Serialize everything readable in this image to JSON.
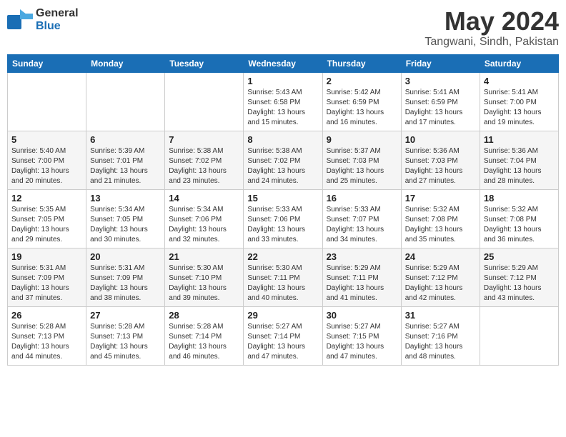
{
  "logo": {
    "general": "General",
    "blue": "Blue"
  },
  "header": {
    "title": "May 2024",
    "subtitle": "Tangwani, Sindh, Pakistan"
  },
  "days": [
    "Sunday",
    "Monday",
    "Tuesday",
    "Wednesday",
    "Thursday",
    "Friday",
    "Saturday"
  ],
  "weeks": [
    [
      {
        "date": "",
        "info": ""
      },
      {
        "date": "",
        "info": ""
      },
      {
        "date": "",
        "info": ""
      },
      {
        "date": "1",
        "info": "Sunrise: 5:43 AM\nSunset: 6:58 PM\nDaylight: 13 hours and 15 minutes."
      },
      {
        "date": "2",
        "info": "Sunrise: 5:42 AM\nSunset: 6:59 PM\nDaylight: 13 hours and 16 minutes."
      },
      {
        "date": "3",
        "info": "Sunrise: 5:41 AM\nSunset: 6:59 PM\nDaylight: 13 hours and 17 minutes."
      },
      {
        "date": "4",
        "info": "Sunrise: 5:41 AM\nSunset: 7:00 PM\nDaylight: 13 hours and 19 minutes."
      }
    ],
    [
      {
        "date": "5",
        "info": "Sunrise: 5:40 AM\nSunset: 7:00 PM\nDaylight: 13 hours and 20 minutes."
      },
      {
        "date": "6",
        "info": "Sunrise: 5:39 AM\nSunset: 7:01 PM\nDaylight: 13 hours and 21 minutes."
      },
      {
        "date": "7",
        "info": "Sunrise: 5:38 AM\nSunset: 7:02 PM\nDaylight: 13 hours and 23 minutes."
      },
      {
        "date": "8",
        "info": "Sunrise: 5:38 AM\nSunset: 7:02 PM\nDaylight: 13 hours and 24 minutes."
      },
      {
        "date": "9",
        "info": "Sunrise: 5:37 AM\nSunset: 7:03 PM\nDaylight: 13 hours and 25 minutes."
      },
      {
        "date": "10",
        "info": "Sunrise: 5:36 AM\nSunset: 7:03 PM\nDaylight: 13 hours and 27 minutes."
      },
      {
        "date": "11",
        "info": "Sunrise: 5:36 AM\nSunset: 7:04 PM\nDaylight: 13 hours and 28 minutes."
      }
    ],
    [
      {
        "date": "12",
        "info": "Sunrise: 5:35 AM\nSunset: 7:05 PM\nDaylight: 13 hours and 29 minutes."
      },
      {
        "date": "13",
        "info": "Sunrise: 5:34 AM\nSunset: 7:05 PM\nDaylight: 13 hours and 30 minutes."
      },
      {
        "date": "14",
        "info": "Sunrise: 5:34 AM\nSunset: 7:06 PM\nDaylight: 13 hours and 32 minutes."
      },
      {
        "date": "15",
        "info": "Sunrise: 5:33 AM\nSunset: 7:06 PM\nDaylight: 13 hours and 33 minutes."
      },
      {
        "date": "16",
        "info": "Sunrise: 5:33 AM\nSunset: 7:07 PM\nDaylight: 13 hours and 34 minutes."
      },
      {
        "date": "17",
        "info": "Sunrise: 5:32 AM\nSunset: 7:08 PM\nDaylight: 13 hours and 35 minutes."
      },
      {
        "date": "18",
        "info": "Sunrise: 5:32 AM\nSunset: 7:08 PM\nDaylight: 13 hours and 36 minutes."
      }
    ],
    [
      {
        "date": "19",
        "info": "Sunrise: 5:31 AM\nSunset: 7:09 PM\nDaylight: 13 hours and 37 minutes."
      },
      {
        "date": "20",
        "info": "Sunrise: 5:31 AM\nSunset: 7:09 PM\nDaylight: 13 hours and 38 minutes."
      },
      {
        "date": "21",
        "info": "Sunrise: 5:30 AM\nSunset: 7:10 PM\nDaylight: 13 hours and 39 minutes."
      },
      {
        "date": "22",
        "info": "Sunrise: 5:30 AM\nSunset: 7:11 PM\nDaylight: 13 hours and 40 minutes."
      },
      {
        "date": "23",
        "info": "Sunrise: 5:29 AM\nSunset: 7:11 PM\nDaylight: 13 hours and 41 minutes."
      },
      {
        "date": "24",
        "info": "Sunrise: 5:29 AM\nSunset: 7:12 PM\nDaylight: 13 hours and 42 minutes."
      },
      {
        "date": "25",
        "info": "Sunrise: 5:29 AM\nSunset: 7:12 PM\nDaylight: 13 hours and 43 minutes."
      }
    ],
    [
      {
        "date": "26",
        "info": "Sunrise: 5:28 AM\nSunset: 7:13 PM\nDaylight: 13 hours and 44 minutes."
      },
      {
        "date": "27",
        "info": "Sunrise: 5:28 AM\nSunset: 7:13 PM\nDaylight: 13 hours and 45 minutes."
      },
      {
        "date": "28",
        "info": "Sunrise: 5:28 AM\nSunset: 7:14 PM\nDaylight: 13 hours and 46 minutes."
      },
      {
        "date": "29",
        "info": "Sunrise: 5:27 AM\nSunset: 7:14 PM\nDaylight: 13 hours and 47 minutes."
      },
      {
        "date": "30",
        "info": "Sunrise: 5:27 AM\nSunset: 7:15 PM\nDaylight: 13 hours and 47 minutes."
      },
      {
        "date": "31",
        "info": "Sunrise: 5:27 AM\nSunset: 7:16 PM\nDaylight: 13 hours and 48 minutes."
      },
      {
        "date": "",
        "info": ""
      }
    ]
  ]
}
